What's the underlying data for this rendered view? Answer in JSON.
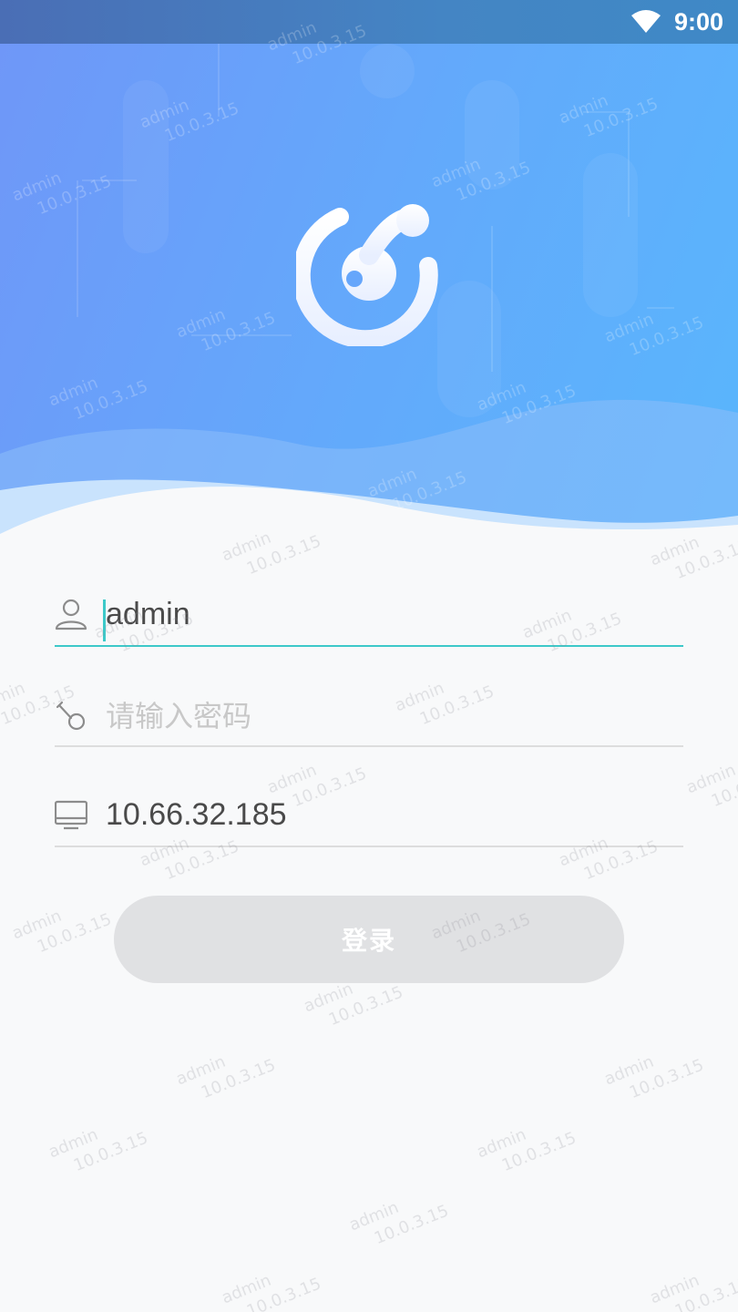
{
  "status_bar": {
    "time": "9:00",
    "icons": [
      "wifi-icon"
    ]
  },
  "logo": {
    "icon": "app-logo-icon",
    "colors": {
      "ring": "#f2f6fe"
    }
  },
  "form": {
    "username": {
      "icon": "user-icon",
      "value": "admin"
    },
    "password": {
      "icon": "key-icon",
      "placeholder": "请输入密码"
    },
    "server": {
      "icon": "monitor-icon",
      "value": "10.66.32.185"
    },
    "login_label": "登录"
  },
  "watermark": {
    "user": "admin",
    "version": "10.0.3.15"
  },
  "colors": {
    "accent": "#3dc9c9",
    "hero_start": "#6f97f8",
    "hero_end": "#59b6fc",
    "button_disabled": "#e0e1e3"
  }
}
